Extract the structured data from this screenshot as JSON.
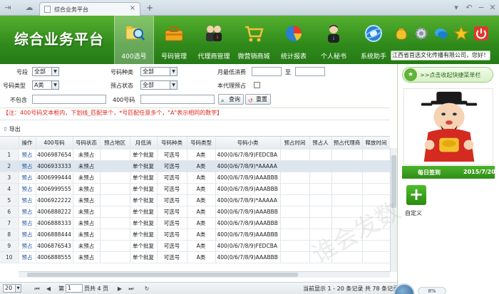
{
  "browser": {
    "tab_title": "综合业务平台",
    "tab_close": "×",
    "new_tab": "+"
  },
  "header": {
    "logo": "综合业务平台",
    "nav": [
      {
        "label": "400选号",
        "icon": "search-folder-icon",
        "active": true
      },
      {
        "label": "号码管理",
        "icon": "toolbox-icon",
        "active": false
      },
      {
        "label": "代理商管理",
        "icon": "users-icon",
        "active": false
      },
      {
        "label": "微营销商城",
        "icon": "shopping-cart-icon",
        "active": false
      },
      {
        "label": "统计报表",
        "icon": "pie-chart-icon",
        "active": false
      },
      {
        "label": "个人秘书",
        "icon": "person-icon",
        "active": false
      },
      {
        "label": "系统助手",
        "icon": "gear-globe-icon",
        "active": false
      }
    ],
    "company": "江西省首选文化传播有限公司，您好！"
  },
  "filter": {
    "segment_label": "号段",
    "segment_value": "全部",
    "number_type_label": "号码种类",
    "number_type_value": "全部",
    "min_spend_label": "月最低消费",
    "to_label": "至",
    "number_class_label": "号码类型",
    "number_class_value": "A类",
    "reserve_status_label": "预占状态",
    "reserve_status_value": "全部",
    "agent_reserve_label": "本代理预占",
    "exclude_label": "不包含",
    "number400_label": "400号码",
    "query_label": "查询",
    "reset_label": "重置",
    "note": "【注：400号码文本框内，下划线_匹配单个，*号匹配任意多个，\"A\"表示相同的数字】"
  },
  "export_label": "导出",
  "table": {
    "headers": [
      "",
      "操作",
      "400号码",
      "号码状态",
      "预占地区",
      "月低消",
      "号码种类",
      "号码类型",
      "号码小类",
      "预占时间",
      "预占人",
      "预占代理商",
      "释放时间"
    ],
    "rows": [
      [
        "1",
        "预占",
        "4006987654",
        "未预占",
        "",
        "单个批复",
        "可选号",
        "A类",
        "400(0/6/7/8/9)FEDCBA"
      ],
      [
        "2",
        "预占",
        "4006933333",
        "未预占",
        "",
        "单个批复",
        "可选号",
        "A类",
        "400(0/6/7/8/9)*AAAAA"
      ],
      [
        "3",
        "预占",
        "4006999444",
        "未预占",
        "",
        "单个批复",
        "可选号",
        "A类",
        "400(0/6/7/8/9)AAABBB"
      ],
      [
        "4",
        "预占",
        "4006999555",
        "未预占",
        "",
        "单个批复",
        "可选号",
        "A类",
        "400(0/6/7/8/9)AAABBB"
      ],
      [
        "5",
        "预占",
        "4006922222",
        "未预占",
        "",
        "单个批复",
        "可选号",
        "A类",
        "400(0/6/7/8/9)*AAAAA"
      ],
      [
        "6",
        "预占",
        "4006888222",
        "未预占",
        "",
        "单个批复",
        "可选号",
        "A类",
        "400(0/6/7/8/9)AAABBB"
      ],
      [
        "7",
        "预占",
        "4006888333",
        "未预占",
        "",
        "单个批复",
        "可选号",
        "A类",
        "400(0/6/7/8/9)AAABBB"
      ],
      [
        "8",
        "预占",
        "4006888444",
        "未预占",
        "",
        "单个批复",
        "可选号",
        "A类",
        "400(0/6/7/8/9)AAABBB"
      ],
      [
        "9",
        "预占",
        "4006876543",
        "未预占",
        "",
        "单个批复",
        "可选号",
        "A类",
        "400(0/6/7/8/9)FEDCBA"
      ],
      [
        "10",
        "预占",
        "4006888555",
        "未预占",
        "",
        "单个批复",
        "可选号",
        "A类",
        "400(0/6/7/8/9)AAABBB"
      ]
    ],
    "selected_row": 1
  },
  "pager": {
    "page_size": "20",
    "page_prefix": "第",
    "current_page": "1",
    "page_suffix": "页共 4 页",
    "summary": "当前显示 1 - 20 条记录 共 78 条记录"
  },
  "right_panel": {
    "favorite_label": ">>点击收起快捷菜单栏",
    "signin_label": "每日签到",
    "signin_date": "2015/7/20",
    "custom_label": "自定义",
    "progress": "8%"
  },
  "watermark": "谁会发数",
  "colors": {
    "header_green": "#2f8a1b",
    "note_red": "#e0261b",
    "link_blue": "#1a4fa0",
    "selected_row": "#dde6ee"
  }
}
